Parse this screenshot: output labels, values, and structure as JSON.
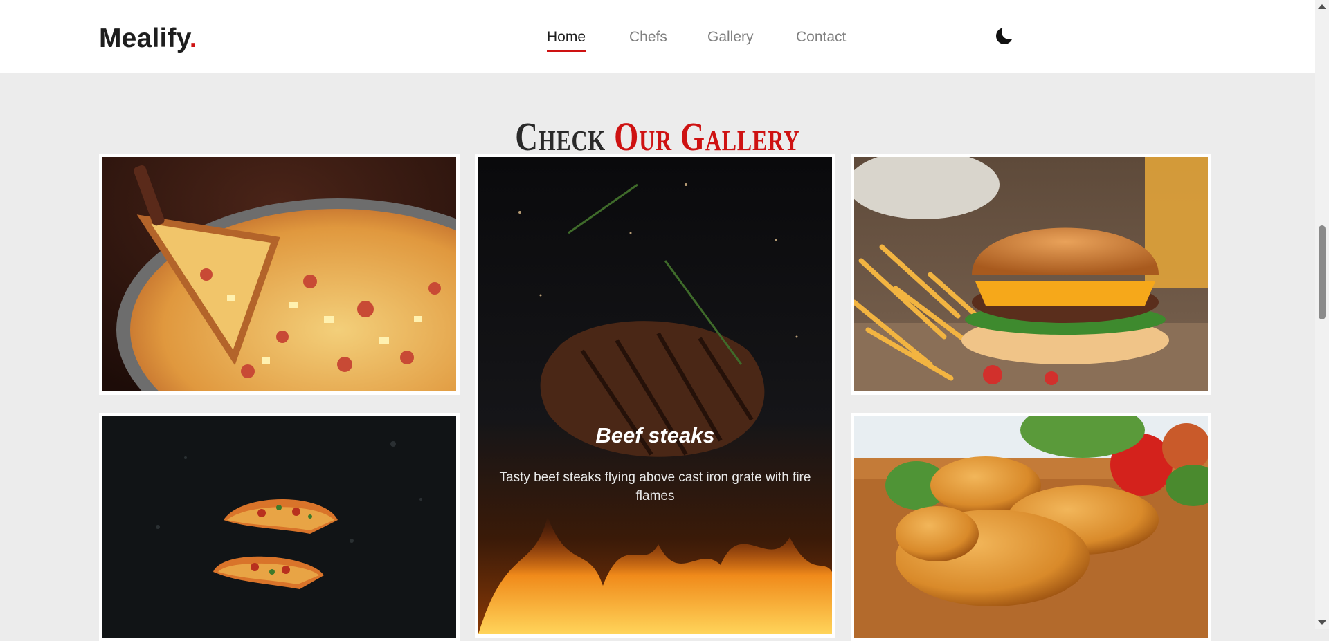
{
  "brand": {
    "name": "Mealify",
    "dot": "."
  },
  "nav": {
    "items": [
      {
        "label": "Home",
        "active": true
      },
      {
        "label": "Chefs",
        "active": false
      },
      {
        "label": "Gallery",
        "active": false
      },
      {
        "label": "Contact",
        "active": false
      }
    ],
    "theme_toggle_icon": "moon-icon"
  },
  "section": {
    "title_prefix": "Check",
    "title_accent": "Our Gallery"
  },
  "gallery": {
    "items": [
      {
        "image": "pizza-slice-photo"
      },
      {
        "image": "beef-steak-photo",
        "title": "Beef steaks",
        "description": "Tasty beef steaks flying above cast iron grate with fire flames"
      },
      {
        "image": "burger-fries-photo"
      },
      {
        "image": "flying-pizza-photo"
      },
      {
        "image": "fried-chicken-photo"
      }
    ]
  },
  "colors": {
    "accent": "#ce1212",
    "text": "#1e1e1e",
    "muted": "#7f7f7f",
    "background": "#ececec"
  }
}
